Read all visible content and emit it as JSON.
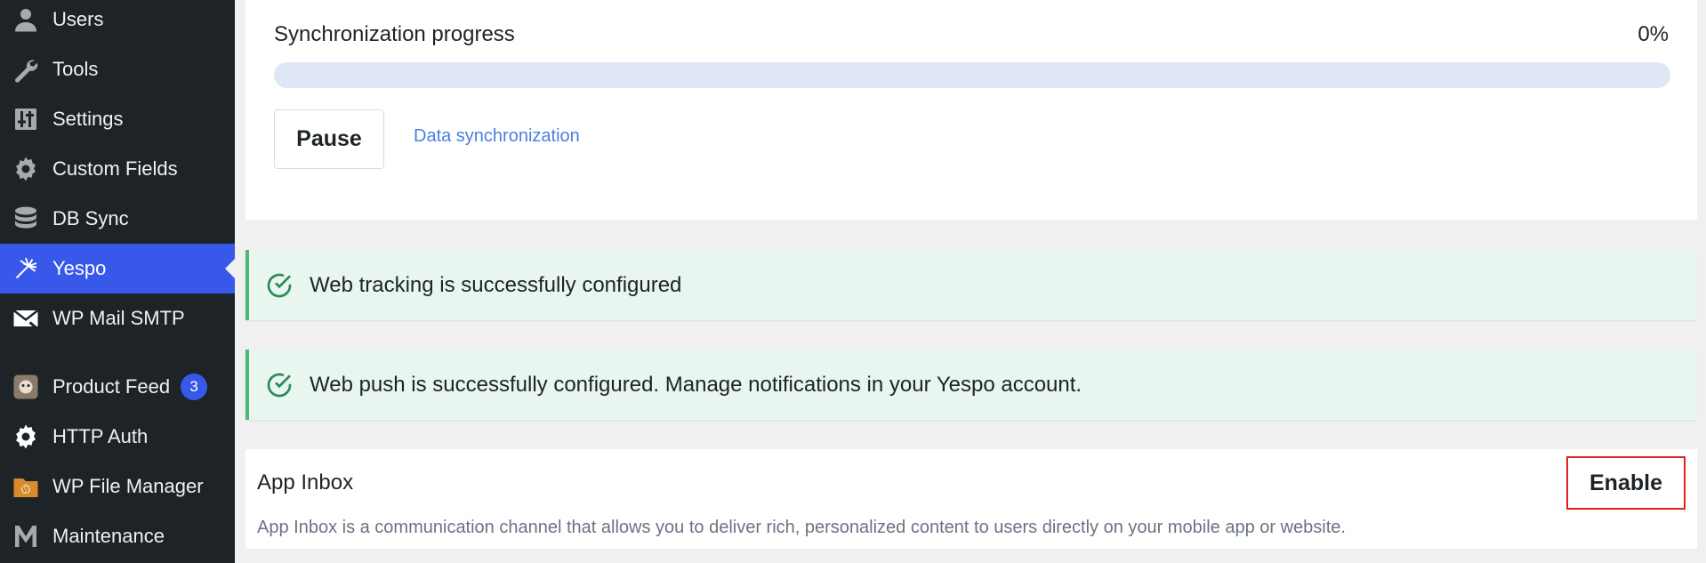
{
  "sidebar": {
    "items": [
      {
        "label": "Users",
        "icon": "users-icon"
      },
      {
        "label": "Tools",
        "icon": "wrench-icon"
      },
      {
        "label": "Settings",
        "icon": "settings-sliders-icon"
      },
      {
        "label": "Custom Fields",
        "icon": "gear-icon"
      },
      {
        "label": "DB Sync",
        "icon": "database-icon"
      },
      {
        "label": "Yespo",
        "icon": "yespo-logo-icon",
        "active": true
      },
      {
        "label": "WP Mail SMTP",
        "icon": "mail-icon"
      },
      {
        "label": "Product Feed",
        "icon": "product-feed-icon",
        "badge": "3"
      },
      {
        "label": "HTTP Auth",
        "icon": "gear-icon"
      },
      {
        "label": "WP File Manager",
        "icon": "file-manager-icon"
      },
      {
        "label": "Maintenance",
        "icon": "maintenance-m-icon"
      }
    ]
  },
  "sync": {
    "title": "Synchronization progress",
    "percent_label": "0%",
    "progress": 0,
    "pause_label": "Pause",
    "link_label": "Data synchronization"
  },
  "notices": [
    {
      "text": "Web tracking is successfully configured",
      "icon": "check-circle-icon"
    },
    {
      "text": "Web push is successfully configured. Manage notifications in your Yespo account.",
      "icon": "check-circle-icon"
    }
  ],
  "app_inbox": {
    "title": "App Inbox",
    "description": "App Inbox is a communication channel that allows you to deliver rich, personalized content to users directly on your mobile app or website.",
    "enable_label": "Enable"
  },
  "colors": {
    "sidebar_bg": "#1d2327",
    "accent": "#3858e9",
    "success_border": "#4fb876",
    "success_bg": "#e8f6ef",
    "highlight_red": "#e02020"
  }
}
